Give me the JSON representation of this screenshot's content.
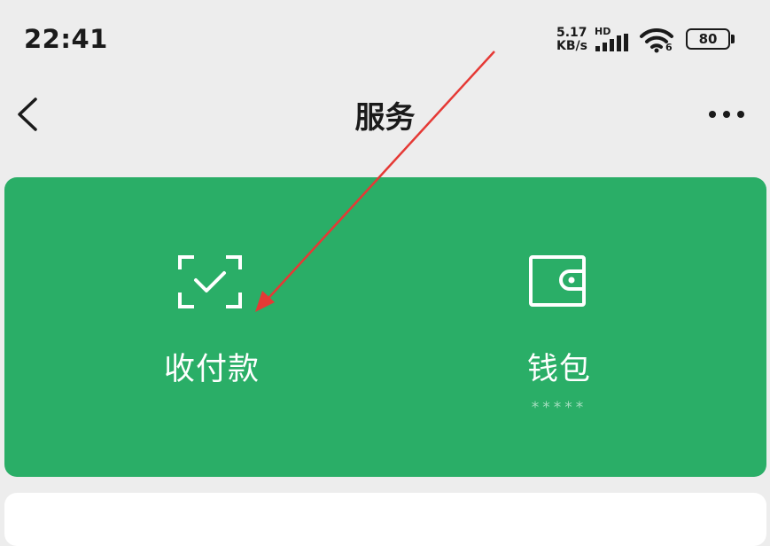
{
  "status_bar": {
    "time": "22:41",
    "net_speed_value": "5.17",
    "net_speed_unit": "KB/s",
    "hd_label": "HD",
    "wifi_sub": "6",
    "battery": "80"
  },
  "header": {
    "title": "服务"
  },
  "service_card": {
    "pay": {
      "label": "收付款"
    },
    "wallet": {
      "label": "钱包",
      "balance_masked": "*****"
    }
  },
  "colors": {
    "card_green": "#2aae67",
    "annotation_arrow": "#e53935",
    "page_background": "#ededed"
  }
}
